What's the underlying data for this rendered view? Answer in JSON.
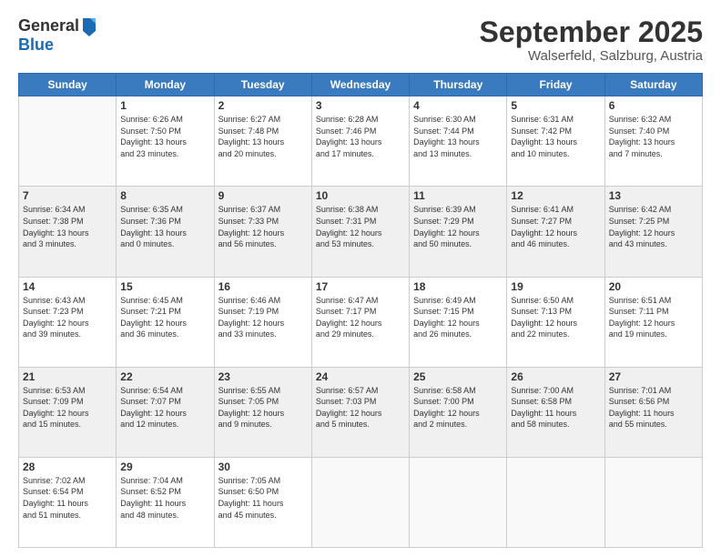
{
  "header": {
    "logo_general": "General",
    "logo_blue": "Blue",
    "month_title": "September 2025",
    "location": "Walserfeld, Salzburg, Austria"
  },
  "days_of_week": [
    "Sunday",
    "Monday",
    "Tuesday",
    "Wednesday",
    "Thursday",
    "Friday",
    "Saturday"
  ],
  "weeks": [
    [
      {
        "day": "",
        "info": ""
      },
      {
        "day": "1",
        "info": "Sunrise: 6:26 AM\nSunset: 7:50 PM\nDaylight: 13 hours\nand 23 minutes."
      },
      {
        "day": "2",
        "info": "Sunrise: 6:27 AM\nSunset: 7:48 PM\nDaylight: 13 hours\nand 20 minutes."
      },
      {
        "day": "3",
        "info": "Sunrise: 6:28 AM\nSunset: 7:46 PM\nDaylight: 13 hours\nand 17 minutes."
      },
      {
        "day": "4",
        "info": "Sunrise: 6:30 AM\nSunset: 7:44 PM\nDaylight: 13 hours\nand 13 minutes."
      },
      {
        "day": "5",
        "info": "Sunrise: 6:31 AM\nSunset: 7:42 PM\nDaylight: 13 hours\nand 10 minutes."
      },
      {
        "day": "6",
        "info": "Sunrise: 6:32 AM\nSunset: 7:40 PM\nDaylight: 13 hours\nand 7 minutes."
      }
    ],
    [
      {
        "day": "7",
        "info": "Sunrise: 6:34 AM\nSunset: 7:38 PM\nDaylight: 13 hours\nand 3 minutes."
      },
      {
        "day": "8",
        "info": "Sunrise: 6:35 AM\nSunset: 7:36 PM\nDaylight: 13 hours\nand 0 minutes."
      },
      {
        "day": "9",
        "info": "Sunrise: 6:37 AM\nSunset: 7:33 PM\nDaylight: 12 hours\nand 56 minutes."
      },
      {
        "day": "10",
        "info": "Sunrise: 6:38 AM\nSunset: 7:31 PM\nDaylight: 12 hours\nand 53 minutes."
      },
      {
        "day": "11",
        "info": "Sunrise: 6:39 AM\nSunset: 7:29 PM\nDaylight: 12 hours\nand 50 minutes."
      },
      {
        "day": "12",
        "info": "Sunrise: 6:41 AM\nSunset: 7:27 PM\nDaylight: 12 hours\nand 46 minutes."
      },
      {
        "day": "13",
        "info": "Sunrise: 6:42 AM\nSunset: 7:25 PM\nDaylight: 12 hours\nand 43 minutes."
      }
    ],
    [
      {
        "day": "14",
        "info": "Sunrise: 6:43 AM\nSunset: 7:23 PM\nDaylight: 12 hours\nand 39 minutes."
      },
      {
        "day": "15",
        "info": "Sunrise: 6:45 AM\nSunset: 7:21 PM\nDaylight: 12 hours\nand 36 minutes."
      },
      {
        "day": "16",
        "info": "Sunrise: 6:46 AM\nSunset: 7:19 PM\nDaylight: 12 hours\nand 33 minutes."
      },
      {
        "day": "17",
        "info": "Sunrise: 6:47 AM\nSunset: 7:17 PM\nDaylight: 12 hours\nand 29 minutes."
      },
      {
        "day": "18",
        "info": "Sunrise: 6:49 AM\nSunset: 7:15 PM\nDaylight: 12 hours\nand 26 minutes."
      },
      {
        "day": "19",
        "info": "Sunrise: 6:50 AM\nSunset: 7:13 PM\nDaylight: 12 hours\nand 22 minutes."
      },
      {
        "day": "20",
        "info": "Sunrise: 6:51 AM\nSunset: 7:11 PM\nDaylight: 12 hours\nand 19 minutes."
      }
    ],
    [
      {
        "day": "21",
        "info": "Sunrise: 6:53 AM\nSunset: 7:09 PM\nDaylight: 12 hours\nand 15 minutes."
      },
      {
        "day": "22",
        "info": "Sunrise: 6:54 AM\nSunset: 7:07 PM\nDaylight: 12 hours\nand 12 minutes."
      },
      {
        "day": "23",
        "info": "Sunrise: 6:55 AM\nSunset: 7:05 PM\nDaylight: 12 hours\nand 9 minutes."
      },
      {
        "day": "24",
        "info": "Sunrise: 6:57 AM\nSunset: 7:03 PM\nDaylight: 12 hours\nand 5 minutes."
      },
      {
        "day": "25",
        "info": "Sunrise: 6:58 AM\nSunset: 7:00 PM\nDaylight: 12 hours\nand 2 minutes."
      },
      {
        "day": "26",
        "info": "Sunrise: 7:00 AM\nSunset: 6:58 PM\nDaylight: 11 hours\nand 58 minutes."
      },
      {
        "day": "27",
        "info": "Sunrise: 7:01 AM\nSunset: 6:56 PM\nDaylight: 11 hours\nand 55 minutes."
      }
    ],
    [
      {
        "day": "28",
        "info": "Sunrise: 7:02 AM\nSunset: 6:54 PM\nDaylight: 11 hours\nand 51 minutes."
      },
      {
        "day": "29",
        "info": "Sunrise: 7:04 AM\nSunset: 6:52 PM\nDaylight: 11 hours\nand 48 minutes."
      },
      {
        "day": "30",
        "info": "Sunrise: 7:05 AM\nSunset: 6:50 PM\nDaylight: 11 hours\nand 45 minutes."
      },
      {
        "day": "",
        "info": ""
      },
      {
        "day": "",
        "info": ""
      },
      {
        "day": "",
        "info": ""
      },
      {
        "day": "",
        "info": ""
      }
    ]
  ]
}
